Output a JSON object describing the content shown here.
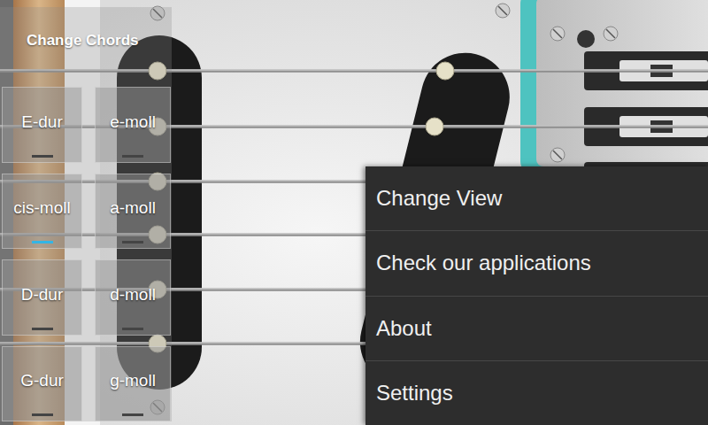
{
  "panel": {
    "title": "Change Chords",
    "chords": [
      {
        "label": "E-dur",
        "selected": false
      },
      {
        "label": "e-moll",
        "selected": false
      },
      {
        "label": "cis-moll",
        "selected": true
      },
      {
        "label": "a-moll",
        "selected": false
      },
      {
        "label": "D-dur",
        "selected": false
      },
      {
        "label": "d-moll",
        "selected": false
      },
      {
        "label": "G-dur",
        "selected": false
      },
      {
        "label": "g-moll",
        "selected": false
      }
    ]
  },
  "menu": {
    "items": [
      "Change View",
      "Check our applications",
      "About",
      "Settings"
    ]
  }
}
